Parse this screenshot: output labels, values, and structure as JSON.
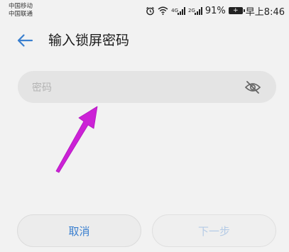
{
  "status_bar": {
    "carrier_1": "中国移动",
    "carrier_2": "中国联通",
    "net_tag_1": "4G",
    "net_tag_2": "2G",
    "battery_percent": "91%",
    "time": "早上8:46",
    "icons": [
      "alarm-icon",
      "wifi-icon",
      "signal-icon",
      "battery-icon"
    ]
  },
  "header": {
    "title": "输入锁屏密码",
    "back_icon": "back-arrow-icon"
  },
  "password": {
    "placeholder": "密码",
    "value": "",
    "visibility_icon": "eye-off-icon"
  },
  "annotation": {
    "color": "#cc22d6"
  },
  "buttons": {
    "cancel_label": "取消",
    "next_label": "下一步",
    "next_enabled": false
  },
  "colors": {
    "accent": "#3a7fcf",
    "disabled_text": "#b5cbe6",
    "background": "#f2f2f2"
  }
}
